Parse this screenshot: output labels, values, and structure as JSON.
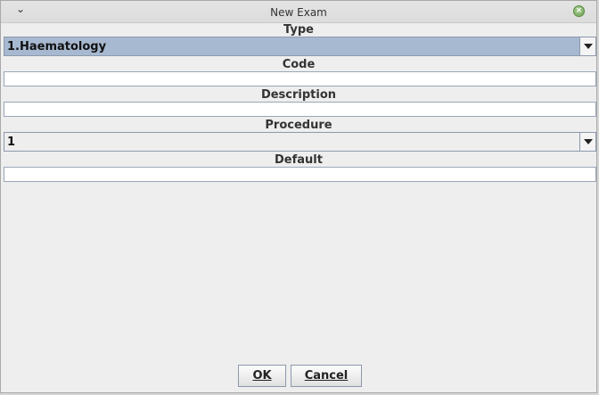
{
  "window": {
    "title": "New Exam"
  },
  "form": {
    "type_label": "Type",
    "type_value": "1.Haematology",
    "code_label": "Code",
    "code_value": "",
    "description_label": "Description",
    "description_value": "",
    "procedure_label": "Procedure",
    "procedure_value": "1",
    "default_label": "Default",
    "default_value": ""
  },
  "buttons": {
    "ok_label": "OK",
    "cancel_label": "Cancel"
  },
  "icons": {
    "menu": "chevron-down-icon",
    "close": "close-icon",
    "dropdown": "caret-down-icon"
  },
  "colors": {
    "selected_combo": "#a7b9d0",
    "close_button": "#7fae66"
  }
}
